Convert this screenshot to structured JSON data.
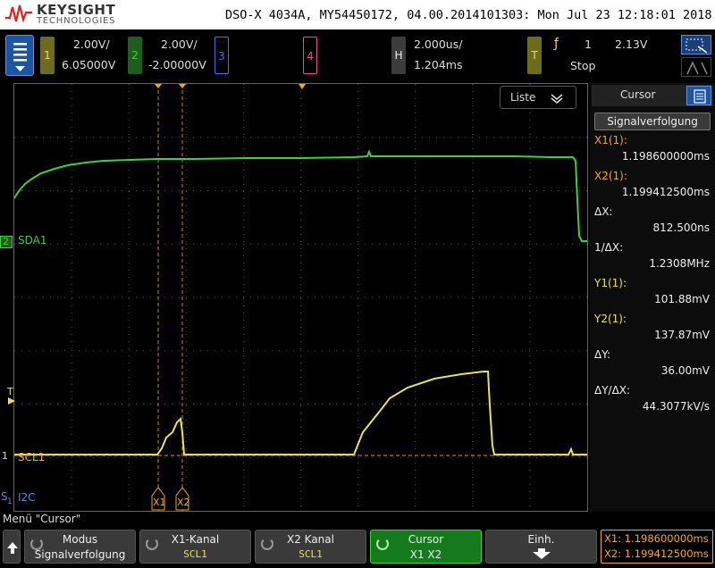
{
  "header": {
    "brand": "KEYSIGHT",
    "brand_sub": "TECHNOLOGIES",
    "title": "DSO-X 4034A, MY54450172, 04.00.2014101303: Mon Jul 23 12:18:01 2018"
  },
  "channels": [
    {
      "num": "1",
      "scale": "2.00V/",
      "offset": "6.05000V",
      "color": "#e8e25a"
    },
    {
      "num": "2",
      "scale": "2.00V/",
      "offset": "-2.00000V",
      "color": "#3fcf3f"
    },
    {
      "num": "3",
      "color": "#4a6eea"
    },
    {
      "num": "4",
      "color": "#e84a9a"
    }
  ],
  "horizontal": {
    "key": "H",
    "scale": "2.000us/",
    "delay": "1.204ms"
  },
  "trigger": {
    "key": "T",
    "edge": "ƒ",
    "source": "1",
    "level": "2.13V",
    "mode": "Stop"
  },
  "grid": {
    "list_button": "Liste",
    "sda_label": "SDA1",
    "scl_label": "SCL1",
    "ch2_marker": "2",
    "ch1_marker": "1",
    "trigger_marker": "T",
    "serial_marker": "S",
    "serial_sub": "1",
    "i2c_label": "I2C",
    "x1_tag": "X1",
    "x2_tag": "X2"
  },
  "cursor_panel": {
    "title": "Cursor",
    "mode_button": "Signalverfolgung",
    "rows": [
      {
        "label": "X1(1):",
        "value": "1.198600000ms",
        "color": "#f5a623"
      },
      {
        "label": "X2(1):",
        "value": "1.199412500ms",
        "color": "#f5a623"
      },
      {
        "label": "ΔX:",
        "value": "812.500ns",
        "color": "#eee"
      },
      {
        "label": "1/ΔX:",
        "value": "1.2308MHz",
        "color": "#eee"
      },
      {
        "label": "Y1(1):",
        "value": "101.88mV",
        "color": "#e8e25a"
      },
      {
        "label": "Y2(1):",
        "value": "137.87mV",
        "color": "#e8e25a"
      },
      {
        "label": "ΔY:",
        "value": "36.00mV",
        "color": "#eee"
      },
      {
        "label": "ΔY/ΔX:",
        "value": "44.3077kV/s",
        "color": "#eee"
      }
    ]
  },
  "menu": {
    "title": "Menü \"Cursor\"",
    "softkeys": [
      {
        "line1": "Modus",
        "line2": "Signalverfolgung"
      },
      {
        "line1": "X1-Kanal",
        "line2": "SCL1"
      },
      {
        "line1": "X2 Kanal",
        "line2": "SCL1"
      },
      {
        "line1": "Cursor",
        "line2": "X1 X2"
      },
      {
        "line1": "Einh.",
        "line2": ""
      }
    ],
    "readout_x1": "X1: 1.198600000ms",
    "readout_x2": "X2: 1.199412500ms"
  },
  "colors": {
    "ch1": "#e8e25a",
    "ch2": "#3fcf3f",
    "cursor": "#f5a623",
    "scl": "#f0b030"
  }
}
